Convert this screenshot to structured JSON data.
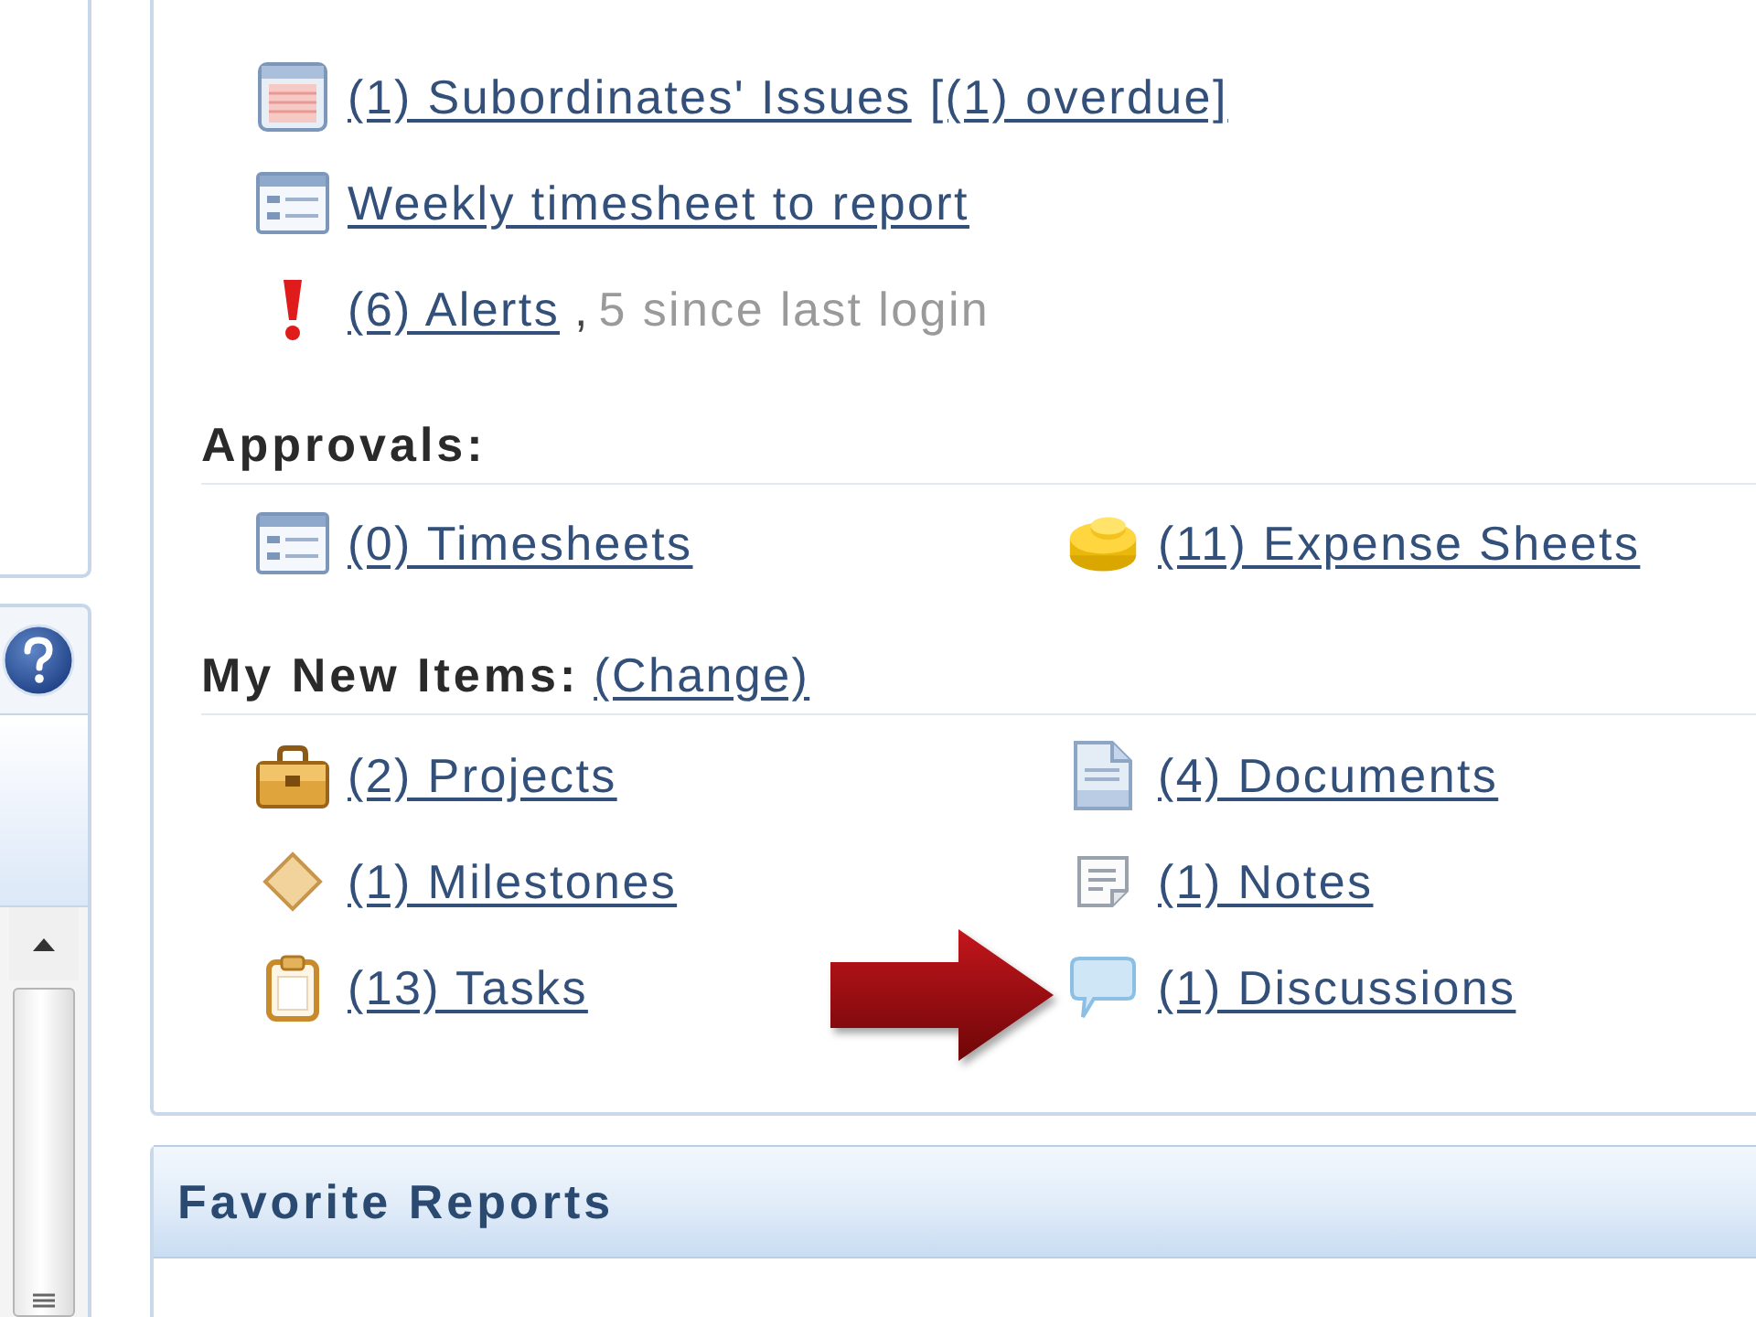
{
  "my_items": [
    {
      "kind": "issues",
      "link": "(1) Subordinates' Issues",
      "extra_link": "[(1) overdue]"
    },
    {
      "kind": "timesheet",
      "link": "Weekly timesheet to report"
    },
    {
      "kind": "alert",
      "link": "(6) Alerts",
      "separator": ",",
      "note": "5 since last login"
    }
  ],
  "approvals": {
    "title": "Approvals:",
    "items": [
      {
        "kind": "timesheet",
        "link": "(0) Timesheets"
      },
      {
        "kind": "coins",
        "link": "(11) Expense Sheets"
      }
    ]
  },
  "new_items": {
    "title": "My New Items:",
    "change_link": "(Change)",
    "items": [
      {
        "kind": "project",
        "link": "(2) Projects"
      },
      {
        "kind": "document",
        "link": "(4) Documents"
      },
      {
        "kind": "milestone",
        "link": "(1) Milestones"
      },
      {
        "kind": "note",
        "link": "(1) Notes"
      },
      {
        "kind": "task",
        "link": "(13) Tasks"
      },
      {
        "kind": "discussion",
        "link": "(1) Discussions"
      }
    ]
  },
  "favorite_reports": {
    "title": "Favorite Reports"
  }
}
